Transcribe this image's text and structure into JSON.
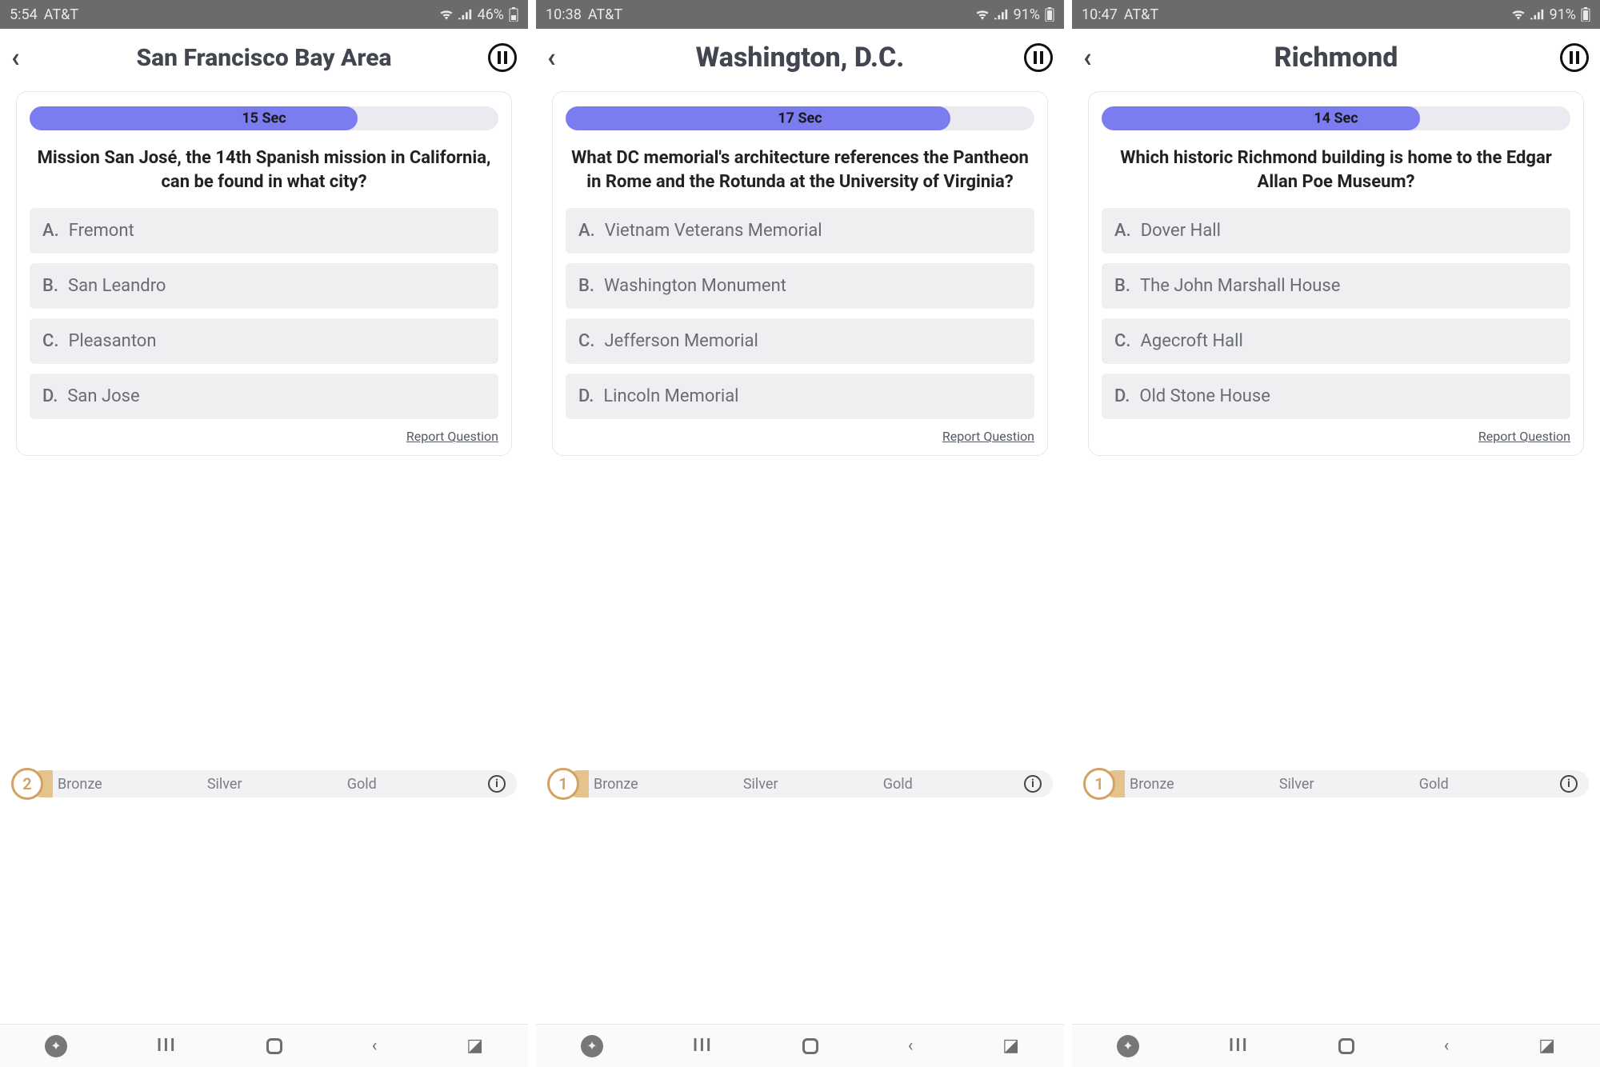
{
  "report_label": "Report Question",
  "tiers": {
    "bronze": "Bronze",
    "silver": "Silver",
    "gold": "Gold"
  },
  "phones": [
    {
      "status": {
        "time": "5:54",
        "carrier": "AT&T",
        "battery": "46%"
      },
      "title": "San Francisco Bay Area",
      "title_small": true,
      "timer": {
        "label": "15 Sec",
        "percent": 70
      },
      "question": "Mission San José, the 14th Spanish mission in California, can be found in what city?",
      "answers": [
        {
          "letter": "A.",
          "text": "Fremont"
        },
        {
          "letter": "B.",
          "text": "San Leandro"
        },
        {
          "letter": "C.",
          "text": "Pleasanton"
        },
        {
          "letter": "D.",
          "text": "San Jose"
        }
      ],
      "progress_number": "2"
    },
    {
      "status": {
        "time": "10:38",
        "carrier": "AT&T",
        "battery": "91%"
      },
      "title": "Washington, D.C.",
      "title_small": false,
      "timer": {
        "label": "17 Sec",
        "percent": 82
      },
      "question": "What DC memorial's architecture references the Pantheon in Rome and the Rotunda at the University of Virginia?",
      "answers": [
        {
          "letter": "A.",
          "text": "Vietnam Veterans Memorial"
        },
        {
          "letter": "B.",
          "text": "Washington Monument"
        },
        {
          "letter": "C.",
          "text": "Jefferson Memorial"
        },
        {
          "letter": "D.",
          "text": "Lincoln Memorial"
        }
      ],
      "progress_number": "1"
    },
    {
      "status": {
        "time": "10:47",
        "carrier": "AT&T",
        "battery": "91%"
      },
      "title": "Richmond",
      "title_small": false,
      "timer": {
        "label": "14 Sec",
        "percent": 68
      },
      "question": "Which historic Richmond building is home to the Edgar Allan Poe Museum?",
      "answers": [
        {
          "letter": "A.",
          "text": "Dover Hall"
        },
        {
          "letter": "B.",
          "text": "The John Marshall House"
        },
        {
          "letter": "C.",
          "text": "Agecroft Hall"
        },
        {
          "letter": "D.",
          "text": "Old Stone House"
        }
      ],
      "progress_number": "1"
    }
  ]
}
